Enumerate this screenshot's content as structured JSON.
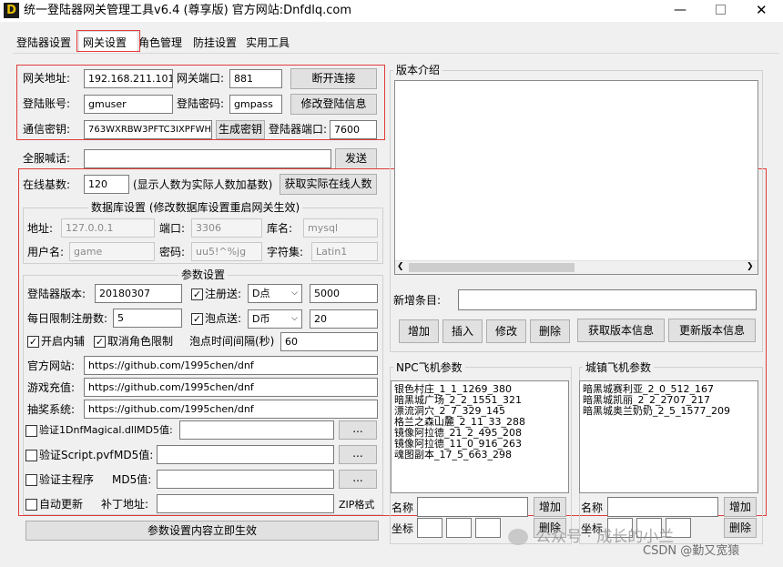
{
  "window": {
    "title": "统一登陆器网关管理工具v6.4 (尊享版)   官方网站:Dnfdlq.com",
    "logo_letter": "D"
  },
  "tabs": [
    {
      "label": "登陆器设置"
    },
    {
      "label": "网关设置"
    },
    {
      "label": "角色管理"
    },
    {
      "label": "防挂设置"
    },
    {
      "label": "实用工具"
    }
  ],
  "gateway": {
    "addr_label": "网关地址:",
    "addr_value": "192.168.211.101",
    "port_label": "网关端口:",
    "port_value": "881",
    "disconnect_button": "断开连接",
    "account_label": "登陆账号:",
    "account_value": "gmuser",
    "password_label": "登陆密码:",
    "password_value": "gmpass",
    "modify_button": "修改登陆信息",
    "key_label": "通信密钥:",
    "key_value": "763WXRBW3PFTC3IXPFWH",
    "genkey_button": "生成密钥",
    "launcher_port_label": "登陆器端口:",
    "launcher_port_value": "7600"
  },
  "broadcast": {
    "label": "全服喊话:",
    "value": "",
    "send_button": "发送"
  },
  "online": {
    "label": "在线基数:",
    "value": "120",
    "hint": "(显示人数为实际人数加基数)",
    "fetch_button": "获取实际在线人数"
  },
  "database": {
    "title": "数据库设置 (修改数据库设置重启网关生效)",
    "addr_label": "地址:",
    "addr_value": "127.0.0.1",
    "port_label": "端口:",
    "port_value": "3306",
    "dbname_label": "库名:",
    "dbname_value": "mysql",
    "user_label": "用户名:",
    "user_value": "game",
    "pwd_label": "密码:",
    "pwd_value": "uu5!^%jg",
    "charset_label": "字符集:",
    "charset_value": "Latin1"
  },
  "params": {
    "title": "参数设置",
    "version_label": "登陆器版本:",
    "version_value": "20180307",
    "register_gift_label": "注册送:",
    "register_gift_checked": "✓",
    "register_gift_type": "D点",
    "register_gift_amount": "5000",
    "daily_limit_label": "每日限制注册数:",
    "daily_limit_value": "5",
    "bubble_gift_label": "泡点送:",
    "bubble_gift_checked": "✓",
    "bubble_gift_type": "D币",
    "bubble_gift_amount": "20",
    "inner_aux_label": "开启内辅",
    "inner_aux_checked": "✓",
    "cancel_role_limit_label": "取消角色限制",
    "cancel_role_limit_checked": "✓",
    "bubble_interval_label": "泡点时间间隔(秒)",
    "bubble_interval_value": "60",
    "site_label": "官方网站:",
    "site_value": "https://github.com/1995chen/dnf",
    "recharge_label": "游戏充值:",
    "recharge_value": "https://github.com/1995chen/dnf",
    "lottery_label": "抽奖系统:",
    "lottery_value": "https://github.com/1995chen/dnf",
    "verify_dll_label": "验证1DnfMagical.dll",
    "md5_label": "MD5值:",
    "verify_pvf_label": "验证Script.pvf",
    "verify_main_label": "验证主程序",
    "browse_button": "...",
    "auto_update_label": "自动更新",
    "patch_label": "补丁地址:",
    "zip_label": "ZIP格式",
    "apply_button": "参数设置内容立即生效"
  },
  "version_intro": {
    "title": "版本介绍",
    "new_item_label": "新增条目:",
    "add_button": "增加",
    "insert_button": "插入",
    "modify_button": "修改",
    "delete_button": "删除",
    "fetch_button": "获取版本信息",
    "update_button": "更新版本信息"
  },
  "npc": {
    "title": "NPC飞机参数",
    "items": [
      "银色村庄_1_1_1269_380",
      "暗黑城广场_2_2_1551_321",
      "漂流洞穴_2_7_329_145",
      "格兰之森山麓_2_11_33_288",
      "镜像阿拉德_21_2_495_208",
      "镜像阿拉德_11_0_916_263",
      "魂图副本_17_5_663_298"
    ],
    "name_label": "名称",
    "coord_label": "坐标",
    "add_button": "增加",
    "delete_button": "删除"
  },
  "city": {
    "title": "城镇飞机参数",
    "items": [
      "暗黑城赛利亚_2_0_512_167",
      "暗黑城凯丽_2_2_2707_217",
      "暗黑城奥兰奶奶_2_5_1577_209"
    ],
    "name_label": "名称",
    "coord_label": "坐标",
    "add_button": "增加",
    "delete_button": "删除"
  },
  "watermark": {
    "wechat": "公众号 · 成长的小兰",
    "csdn": "CSDN @勤又宽猿"
  }
}
